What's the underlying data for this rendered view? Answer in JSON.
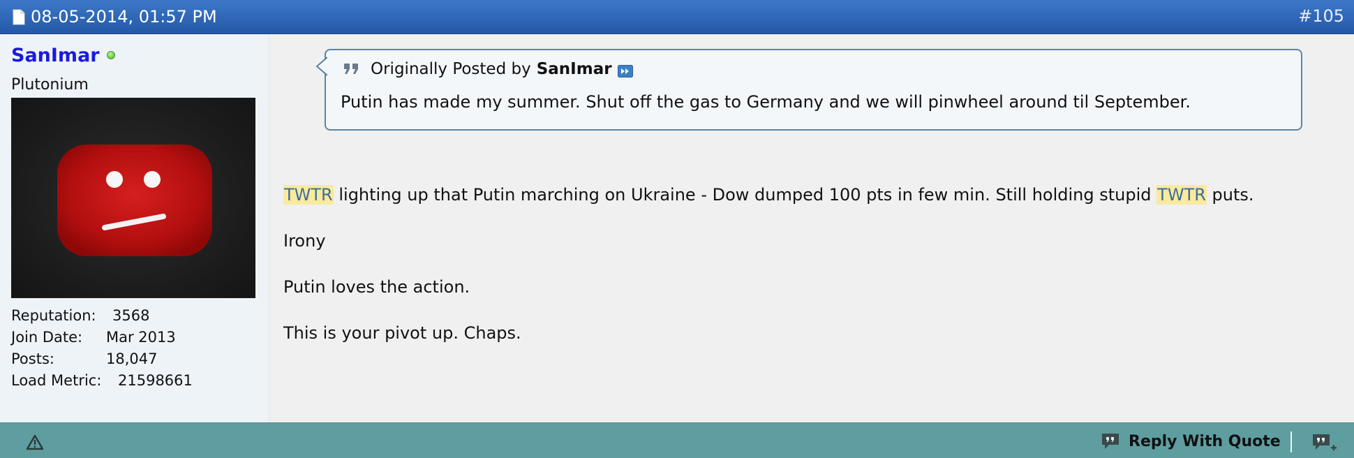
{
  "post": {
    "date": "08-05-2014, 01:57 PM",
    "number": "#105"
  },
  "user": {
    "name": "SanImar",
    "title": "Plutonium",
    "status": "online",
    "stats": [
      {
        "label": "Reputation:",
        "value": "3568"
      },
      {
        "label": "Join Date:",
        "value": "Mar 2013"
      },
      {
        "label": "Posts:",
        "value": "18,047"
      },
      {
        "label": "Load Metric:",
        "value": "21598661"
      }
    ]
  },
  "quote": {
    "prefix": "Originally Posted by",
    "author": "SanImar",
    "text": "Putin has made my summer. Shut off the gas to Germany and we will pinwheel around til September."
  },
  "message": {
    "line1": {
      "ticker": "TWTR",
      "middle": " lighting up that Putin marching on Ukraine - Dow dumped 100 pts in few min. Still holding stupid ",
      "ticker2": "TWTR",
      "end": " puts."
    },
    "line2": "Irony",
    "line3": "Putin loves the action.",
    "line4": "This is your pivot up. Chaps."
  },
  "footer": {
    "reply_quote_label": "Reply With Quote"
  },
  "colors": {
    "header": "#2f68b8",
    "footer": "#5f9ea0",
    "username": "#1a1ae0",
    "highlight": "#fbe99d",
    "quote_border": "#5d83a3"
  },
  "icons": [
    "document-icon",
    "online-status-icon",
    "quote-marks-icon",
    "view-post-icon",
    "warning-icon",
    "reply-icon",
    "multi-quote-icon"
  ]
}
